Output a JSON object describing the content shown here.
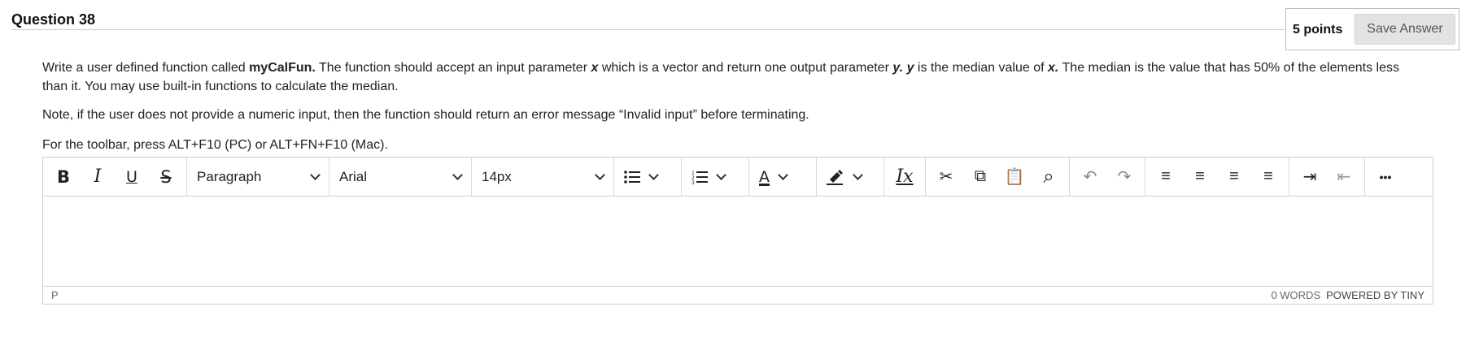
{
  "question": {
    "title": "Question 38",
    "points": "5 points",
    "save_label": "Save Answer"
  },
  "prompt": {
    "p1_a": "Write a user defined function called ",
    "p1_fn": "myCalFun.",
    "p1_b": "  The function should accept an input parameter ",
    "p1_x": "x",
    "p1_c": " which is a vector and return one output parameter ",
    "p1_y": "y.",
    "p1_y2": "y",
    "p1_d": " is the median value of ",
    "p1_x2": "x.",
    "p1_e": "  The median is the value that has 50% of the elements less than it.  You may use built-in functions to calculate the median.",
    "p2": "Note, if the user does not provide a numeric input, then the function should return an error message “Invalid input” before terminating."
  },
  "editor": {
    "hint": "For the toolbar, press ALT+F10 (PC) or ALT+FN+F10 (Mac).",
    "block_format": "Paragraph",
    "font_family": "Arial",
    "font_size": "14px",
    "icons": {
      "bold": "B",
      "italic": "I",
      "underline": "U",
      "strike": "S",
      "bullets": "☰",
      "numbers": "☷",
      "text_color": "A",
      "highlight": "✎",
      "clear": "Ix",
      "cut": "✂",
      "copy": "⧉",
      "paste": "📋",
      "find": "⌕",
      "undo": "↶",
      "redo": "↷",
      "align_left": "≡",
      "align_center": "≡",
      "align_right": "≡",
      "justify": "≡",
      "indent": "⇥",
      "outdent": "⇤",
      "more": "•••"
    },
    "path": "P",
    "word_count": "0 WORDS",
    "powered_by": "POWERED BY TINY"
  }
}
